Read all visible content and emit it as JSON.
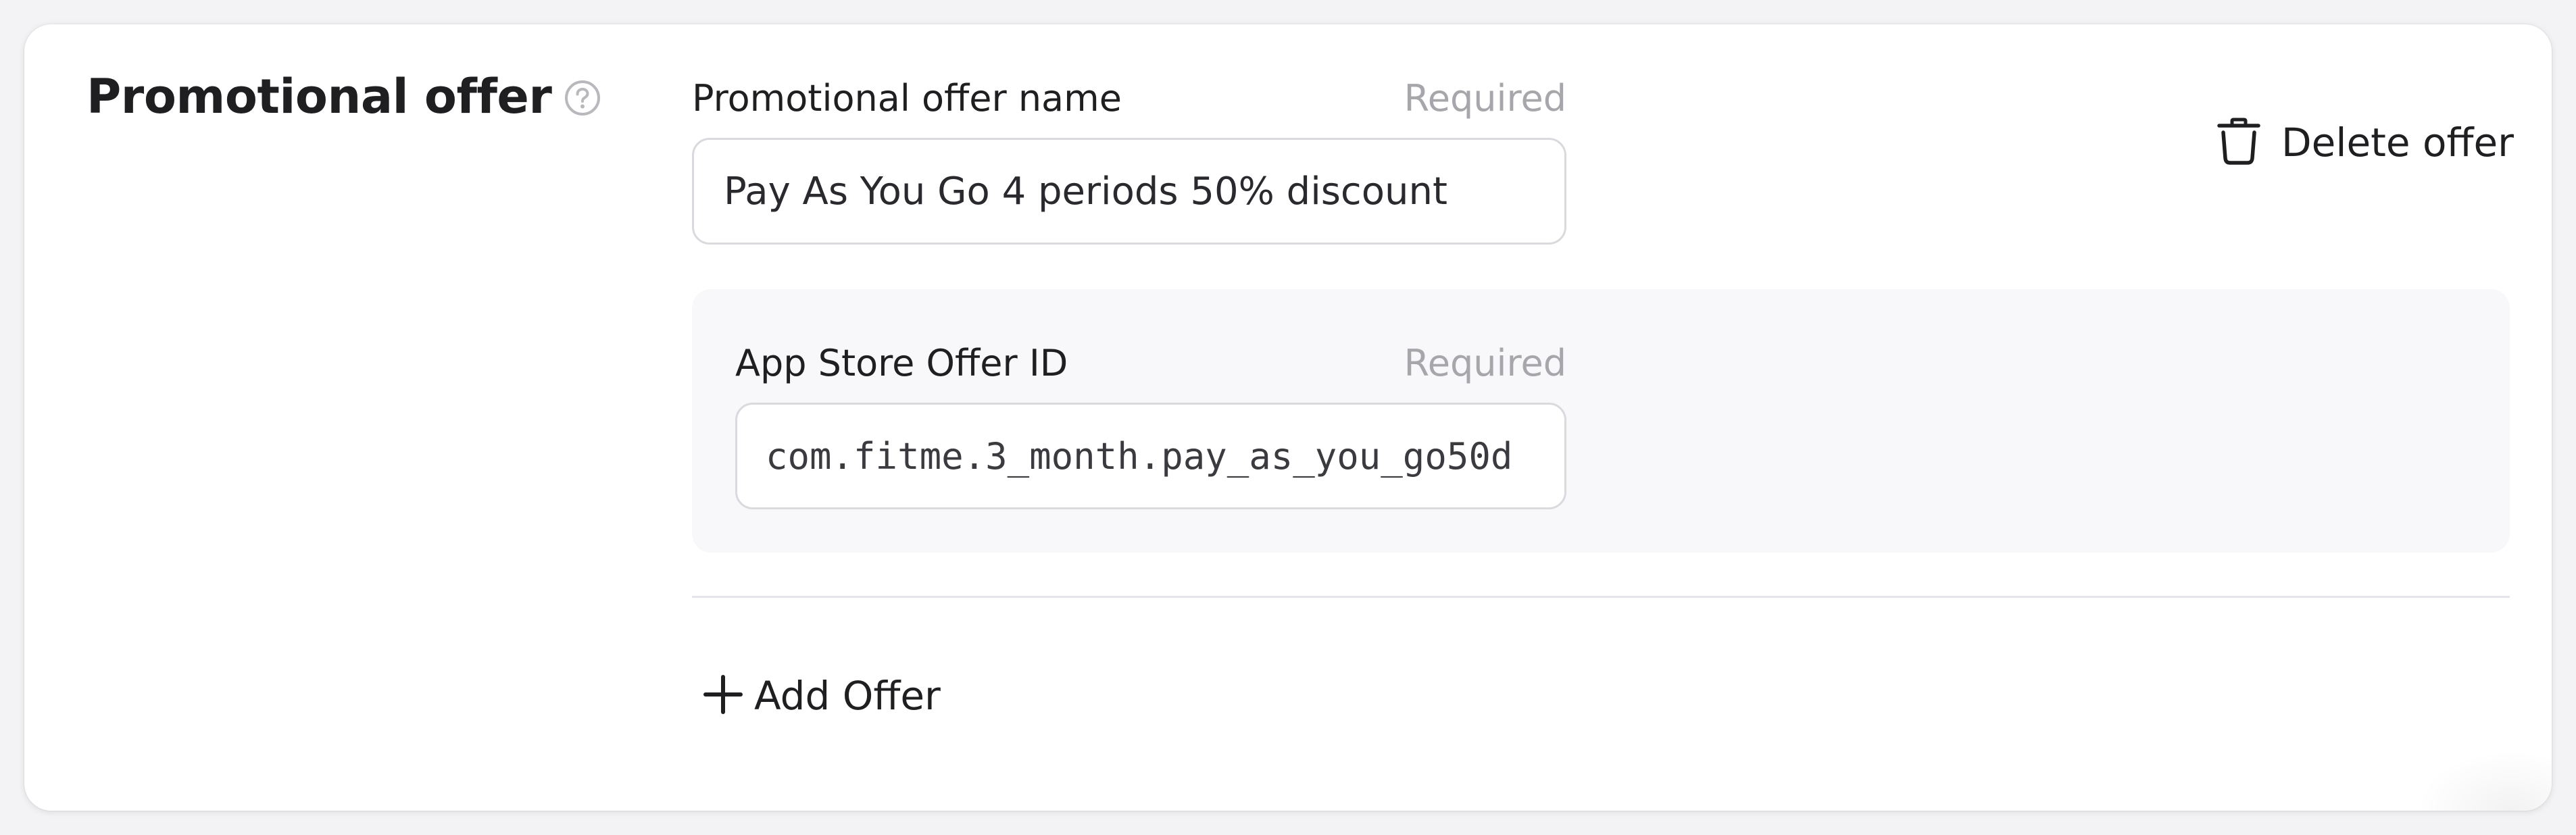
{
  "section": {
    "title": "Promotional offer",
    "help_icon": "question-circle-icon"
  },
  "offer_name": {
    "label": "Promotional offer name",
    "required_label": "Required",
    "value": "Pay As You Go 4 periods 50% discount"
  },
  "app_store_offer": {
    "label": "App Store Offer ID",
    "required_label": "Required",
    "value": "com.fitme.3_month.pay_as_you_go50d"
  },
  "actions": {
    "delete_label": "Delete offer",
    "delete_icon": "trash-icon",
    "add_label": "Add Offer",
    "add_icon": "plus-icon"
  }
}
